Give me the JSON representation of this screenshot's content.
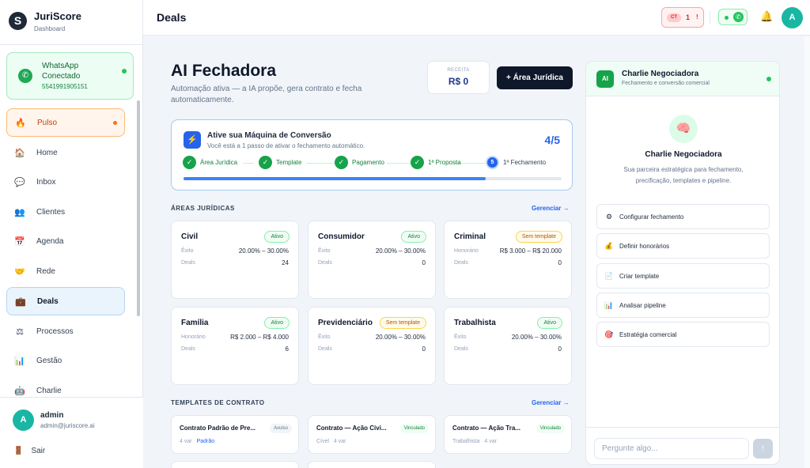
{
  "brand": {
    "title": "JuriScore",
    "subtitle": "Dashboard",
    "logo": "S"
  },
  "whatsapp": {
    "title": "WhatsApp Conectado",
    "number": "5541991905151"
  },
  "nav": [
    {
      "label": "Pulso",
      "icon": "🔥"
    },
    {
      "label": "Home",
      "icon": "🏠"
    },
    {
      "label": "Inbox",
      "icon": "💬"
    },
    {
      "label": "Clientes",
      "icon": "👥"
    },
    {
      "label": "Agenda",
      "icon": "📅"
    },
    {
      "label": "Rede",
      "icon": "🤝"
    },
    {
      "label": "Deals",
      "icon": "💼"
    },
    {
      "label": "Processos",
      "icon": "⚖"
    },
    {
      "label": "Gestão",
      "icon": "📊"
    },
    {
      "label": "Charlie",
      "icon": "🤖"
    }
  ],
  "user": {
    "initial": "A",
    "name": "admin",
    "email": "admin@juriscore.ai",
    "logout": "Sair",
    "logout_icon": "🚪"
  },
  "topbar": {
    "title": "Deals",
    "ct_badge": "CT",
    "ct_count": "1",
    "ct_alert": "!",
    "wa_icon": "✆",
    "bell_icon": "🔔",
    "avatar": "A"
  },
  "header": {
    "title": "AI Fechadora",
    "subtitle": "Automação ativa — a IA propõe, gera contrato e fecha automaticamente.",
    "receita_label": "RECEITA",
    "receita_value": "R$ 0",
    "add_button": "+ Área Jurídica"
  },
  "conversion": {
    "icon": "⚡",
    "title": "Ative sua Máquina de Conversão",
    "subtitle": "Você está a 1 passo de ativar o fechamento automático.",
    "count": "4/5",
    "progress": 0.8,
    "steps": [
      {
        "label": "Área Jurídica",
        "mark": "✓"
      },
      {
        "label": "Template",
        "mark": "✓"
      },
      {
        "label": "Pagamento",
        "mark": "✓"
      },
      {
        "label": "1ª Proposta",
        "mark": "✓"
      },
      {
        "label": "1º Fechamento",
        "mark": "5"
      }
    ]
  },
  "areas": {
    "title": "ÁREAS JURÍDICAS",
    "manage": "Gerenciar →",
    "items": [
      {
        "name": "Civil",
        "badge": "Ativo",
        "l1": "Êxito",
        "v1": "20.00% – 30.00%",
        "l2": "Deals",
        "v2": "24"
      },
      {
        "name": "Consumidor",
        "badge": "Ativo",
        "l1": "Êxito",
        "v1": "20.00% – 30.00%",
        "l2": "Deals",
        "v2": "0"
      },
      {
        "name": "Criminal",
        "badge": "Sem template",
        "l1": "Honorário",
        "v1": "R$ 3.000 – R$ 20.000",
        "l2": "Deals",
        "v2": "0"
      },
      {
        "name": "Família",
        "badge": "Ativo",
        "l1": "Honorário",
        "v1": "R$ 2.000 – R$ 4.000",
        "l2": "Deals",
        "v2": "6"
      },
      {
        "name": "Previdenciário",
        "badge": "Sem template",
        "l1": "Êxito",
        "v1": "20.00% – 30.00%",
        "l2": "Deals",
        "v2": "0"
      },
      {
        "name": "Trabalhista",
        "badge": "Ativo",
        "l1": "Êxito",
        "v1": "20.00% – 30.00%",
        "l2": "Deals",
        "v2": "0"
      }
    ]
  },
  "templates": {
    "title": "TEMPLATES DE CONTRATO",
    "manage": "Gerenciar →",
    "items": [
      {
        "name": "Contrato Padrão de Pre...",
        "badge": "Avulso",
        "meta1": "4 var",
        "meta2": "Padrão"
      },
      {
        "name": "Contrato — Ação Civi...",
        "badge": "Vinculado",
        "meta1": "Cível",
        "meta2": "4 var"
      },
      {
        "name": "Contrato — Ação Tra...",
        "badge": "Vinculado",
        "meta1": "Trabalhista",
        "meta2": "4 var"
      }
    ]
  },
  "charlie": {
    "avatar": "AI",
    "name": "Charlie Negociadora",
    "subtitle": "Fechamento e conversão comercial",
    "brain_icon": "🧠",
    "title": "Charlie Negociadora",
    "desc": "Sua parceira estratégica para fechamento, precificação, templates e pipeline.",
    "actions": [
      {
        "label": "Configurar fechamento",
        "icon": "⚙"
      },
      {
        "label": "Definir honorários",
        "icon": "💰"
      },
      {
        "label": "Criar template",
        "icon": "📄"
      },
      {
        "label": "Analisar pipeline",
        "icon": "📊"
      },
      {
        "label": "Estratégia comercial",
        "icon": "🎯"
      }
    ],
    "input_placeholder": "Pergunte algo...",
    "send_icon": "↑"
  }
}
